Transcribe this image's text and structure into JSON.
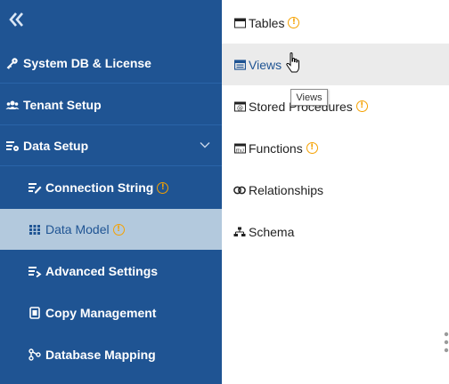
{
  "sidebar": {
    "collapse_icon": "double-chevron-left-icon",
    "items": [
      {
        "label": "System DB & License",
        "icon": "key-icon"
      },
      {
        "label": "Tenant Setup",
        "icon": "users-icon"
      },
      {
        "label": "Data Setup",
        "icon": "data-settings-icon",
        "expanded": true
      },
      {
        "label": "Connection String",
        "icon": "edit-list-icon",
        "warning": "!"
      },
      {
        "label": "Data Model",
        "icon": "grid-icon",
        "warning": "!",
        "active": true
      },
      {
        "label": "Advanced Settings",
        "icon": "list-arrow-icon"
      },
      {
        "label": "Copy Management",
        "icon": "copy-icon"
      },
      {
        "label": "Database Mapping",
        "icon": "mapping-icon"
      }
    ]
  },
  "submenu": {
    "items": [
      {
        "label": "Tables",
        "icon": "table-icon",
        "warning": "!"
      },
      {
        "label": "Views",
        "icon": "view-icon",
        "hovered": true
      },
      {
        "label": "Stored Procedures",
        "icon": "stored-procedure-icon",
        "warning": "!"
      },
      {
        "label": "Functions",
        "icon": "function-icon",
        "warning": "!"
      },
      {
        "label": "Relationships",
        "icon": "link-icon"
      },
      {
        "label": "Schema",
        "icon": "schema-icon"
      }
    ]
  },
  "tooltip": {
    "text": "Views"
  },
  "colors": {
    "sidebar_bg": "#1f5493",
    "active_bg": "#b3c9dd",
    "warning": "#f5a100",
    "hover_bg": "#ebebeb"
  }
}
